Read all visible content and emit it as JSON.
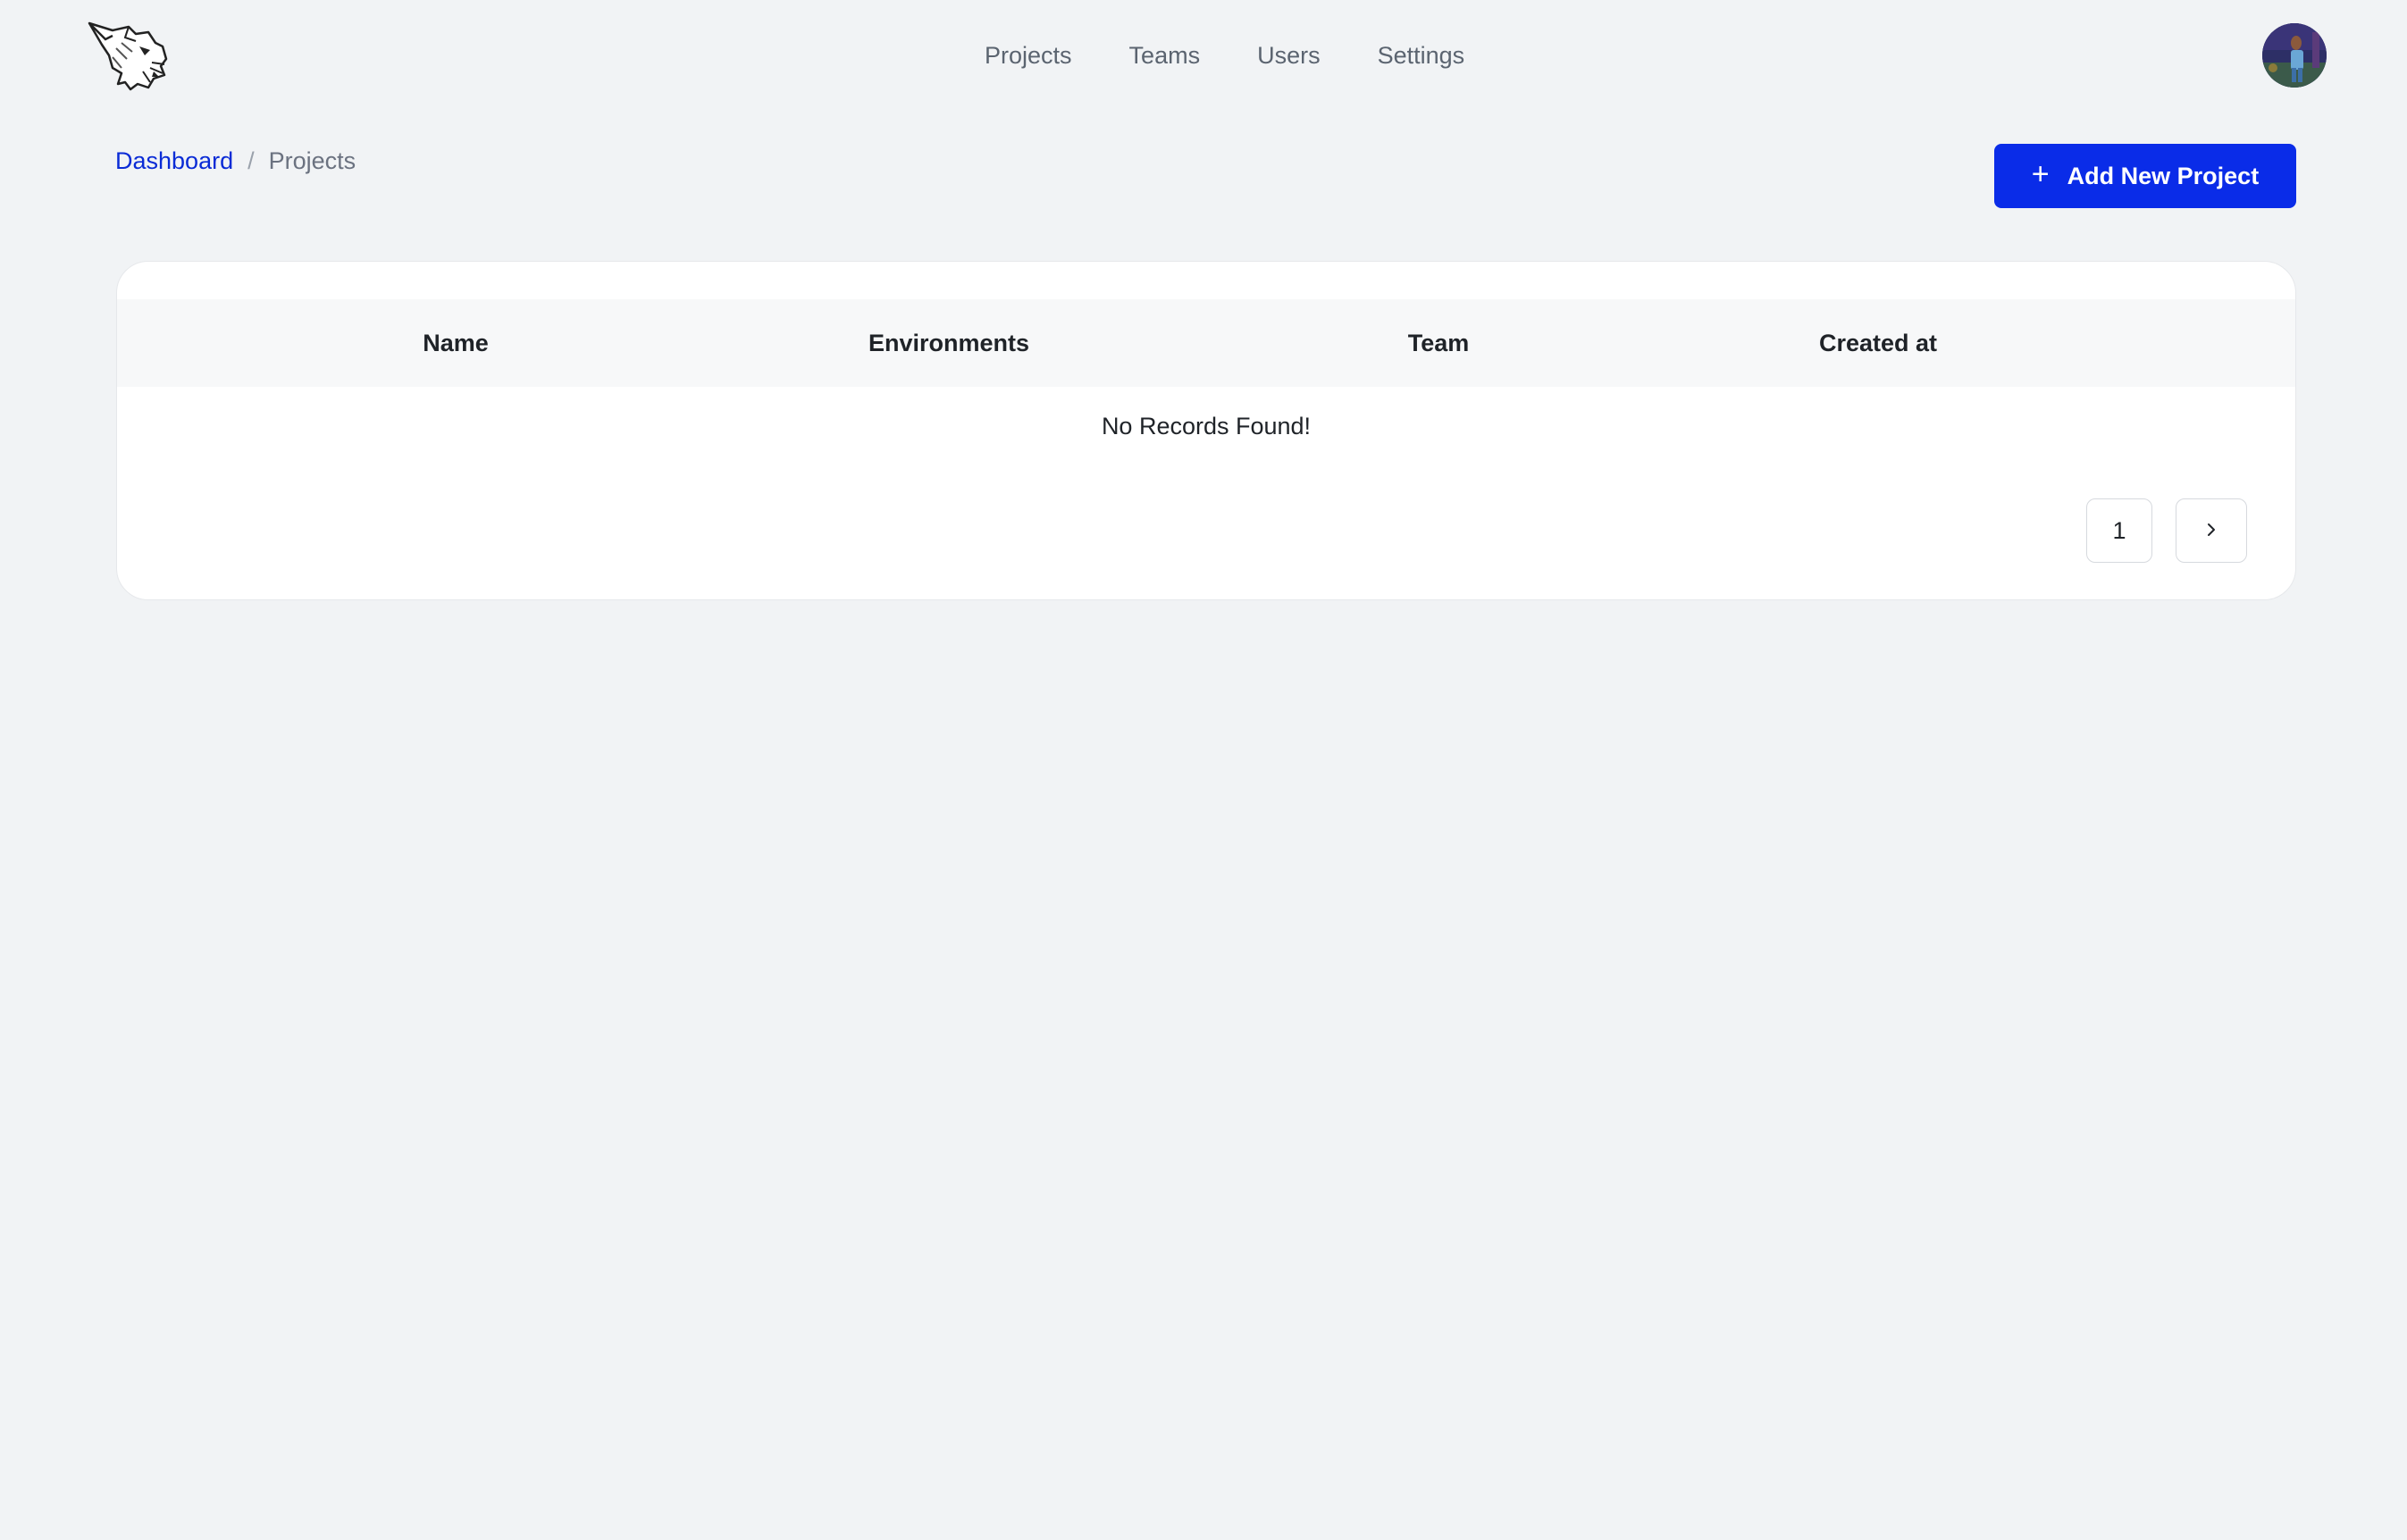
{
  "nav": {
    "items": [
      {
        "label": "Projects"
      },
      {
        "label": "Teams"
      },
      {
        "label": "Users"
      },
      {
        "label": "Settings"
      }
    ]
  },
  "breadcrumb": {
    "parent": "Dashboard",
    "separator": "/",
    "current": "Projects"
  },
  "actions": {
    "add_icon": "+",
    "add_label": "Add New Project"
  },
  "table": {
    "columns": [
      "Name",
      "Environments",
      "Team",
      "Created at"
    ],
    "empty_message": "No Records Found!"
  },
  "pagination": {
    "current_page": "1",
    "next_icon": "chevron-right-icon"
  },
  "colors": {
    "accent": "#0a2ce8",
    "link": "#0a2bd6",
    "background": "#f1f3f5"
  }
}
